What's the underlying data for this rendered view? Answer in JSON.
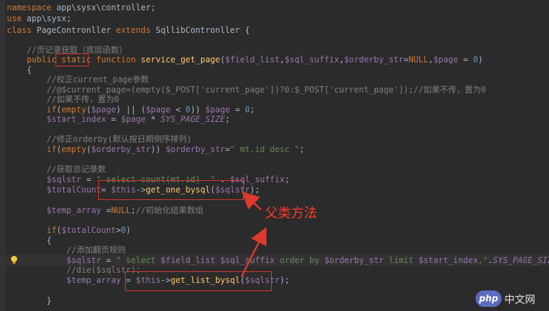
{
  "code_lines": [
    "namespace app\\sysx\\controller;",
    "use app\\sysx;",
    "class PageContronller extends SqllibContronller {",
    "",
    "    //页记录获取（底层函数）",
    "    public static function service_get_page($field_list,$sql_suffix,$orderby_str=NULL,$page = 0)",
    "    {",
    "        //校正current_page参数",
    "        //@$current_page=(empty($_POST['current_page'])?0:$_POST['current_page']);//如果不传，置为0",
    "        //如果不传，置为0",
    "        if(empty($page) || ($page < 0)) $page = 0;",
    "        $start_index = $page * SYS_PAGE_SIZE;",
    "",
    "        //修正orderby(默认按日期倒序排列)",
    "        if(empty($orderby_str)) $orderby_str=\" mt.id desc \";",
    "",
    "        //获取总记录数",
    "        $sqlstr = \" select count(mt.id)  \" . $sql_suffix;",
    "        $totalCount= $this->get_one_bysql($sqlstr);",
    "",
    "        $temp_array =NULL;//初始化结果数组",
    "",
    "        if($totalCount>0)",
    "        {",
    "            //添加翻页规则",
    "            $sqlstr = \" select $field_list $sql_suffix order by $orderby_str limit $start_index,\".SYS_PAGE_SIZE;",
    "            //die($sqlstr);",
    "            $temp_array = $this->get_list_bysql($sqlstr);",
    "",
    "        }"
  ],
  "annotation": "父类方法",
  "watermark": {
    "badge": "php",
    "text": "中文网"
  },
  "colors": {
    "background": "#2b2b2b",
    "keyword": "#cc7832",
    "function": "#ffc66d",
    "variable": "#9876aa",
    "string": "#6a8759",
    "comment": "#808080",
    "annotation": "#ff3b2f"
  }
}
